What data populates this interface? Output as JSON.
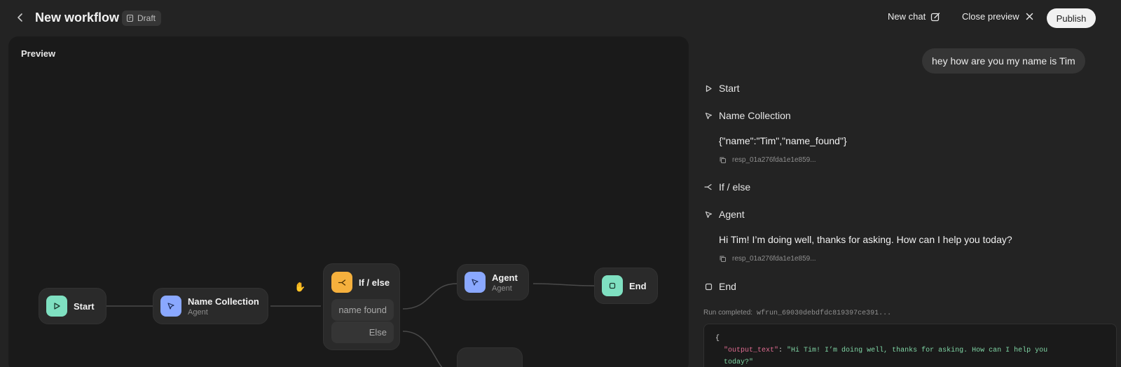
{
  "header": {
    "title": "New workflow",
    "badge": "Draft",
    "new_chat": "New chat",
    "close_preview": "Close preview",
    "publish": "Publish"
  },
  "preview": {
    "label": "Preview",
    "nodes": {
      "start": {
        "title": "Start",
        "icon": "play-icon",
        "color": "#7fe0c1"
      },
      "name_collection": {
        "title": "Name Collection",
        "subtitle": "Agent",
        "icon": "cursor-arrow-icon",
        "color": "#8aa8ff"
      },
      "if_else": {
        "title": "If / else",
        "icon": "branch-icon",
        "color": "#f5b03d",
        "conditions": [
          "name found",
          "Else"
        ]
      },
      "agent": {
        "title": "Agent",
        "subtitle": "Agent",
        "icon": "cursor-arrow-icon",
        "color": "#8aa8ff"
      },
      "end": {
        "title": "End",
        "icon": "stop-square-icon",
        "color": "#7fe0c1"
      }
    }
  },
  "chat": {
    "user_message": "hey how are you my name is Tim",
    "steps": [
      {
        "label": "Start",
        "icon": "play-icon"
      },
      {
        "label": "Name Collection",
        "icon": "cursor-arrow-icon",
        "output": "{\"name\":\"Tim\",\"name_found\"}",
        "response_id": "resp_01a276fda1e1e859..."
      },
      {
        "label": "If / else",
        "icon": "branch-icon"
      },
      {
        "label": "Agent",
        "icon": "cursor-arrow-icon",
        "output": "Hi Tim! I’m doing well, thanks for asking. How can I help you today?",
        "response_id": "resp_01a276fda1e1e859..."
      },
      {
        "label": "End",
        "icon": "stop-square-icon"
      }
    ],
    "run_completed_label": "Run completed:",
    "run_id": "wfrun_69030debdfdc819397ce391...",
    "code": {
      "open": "{",
      "key": "\"output_text\"",
      "value": "\"Hi Tim! I’m doing well, thanks for asking. How can I help you",
      "continuation": "today?\""
    }
  }
}
